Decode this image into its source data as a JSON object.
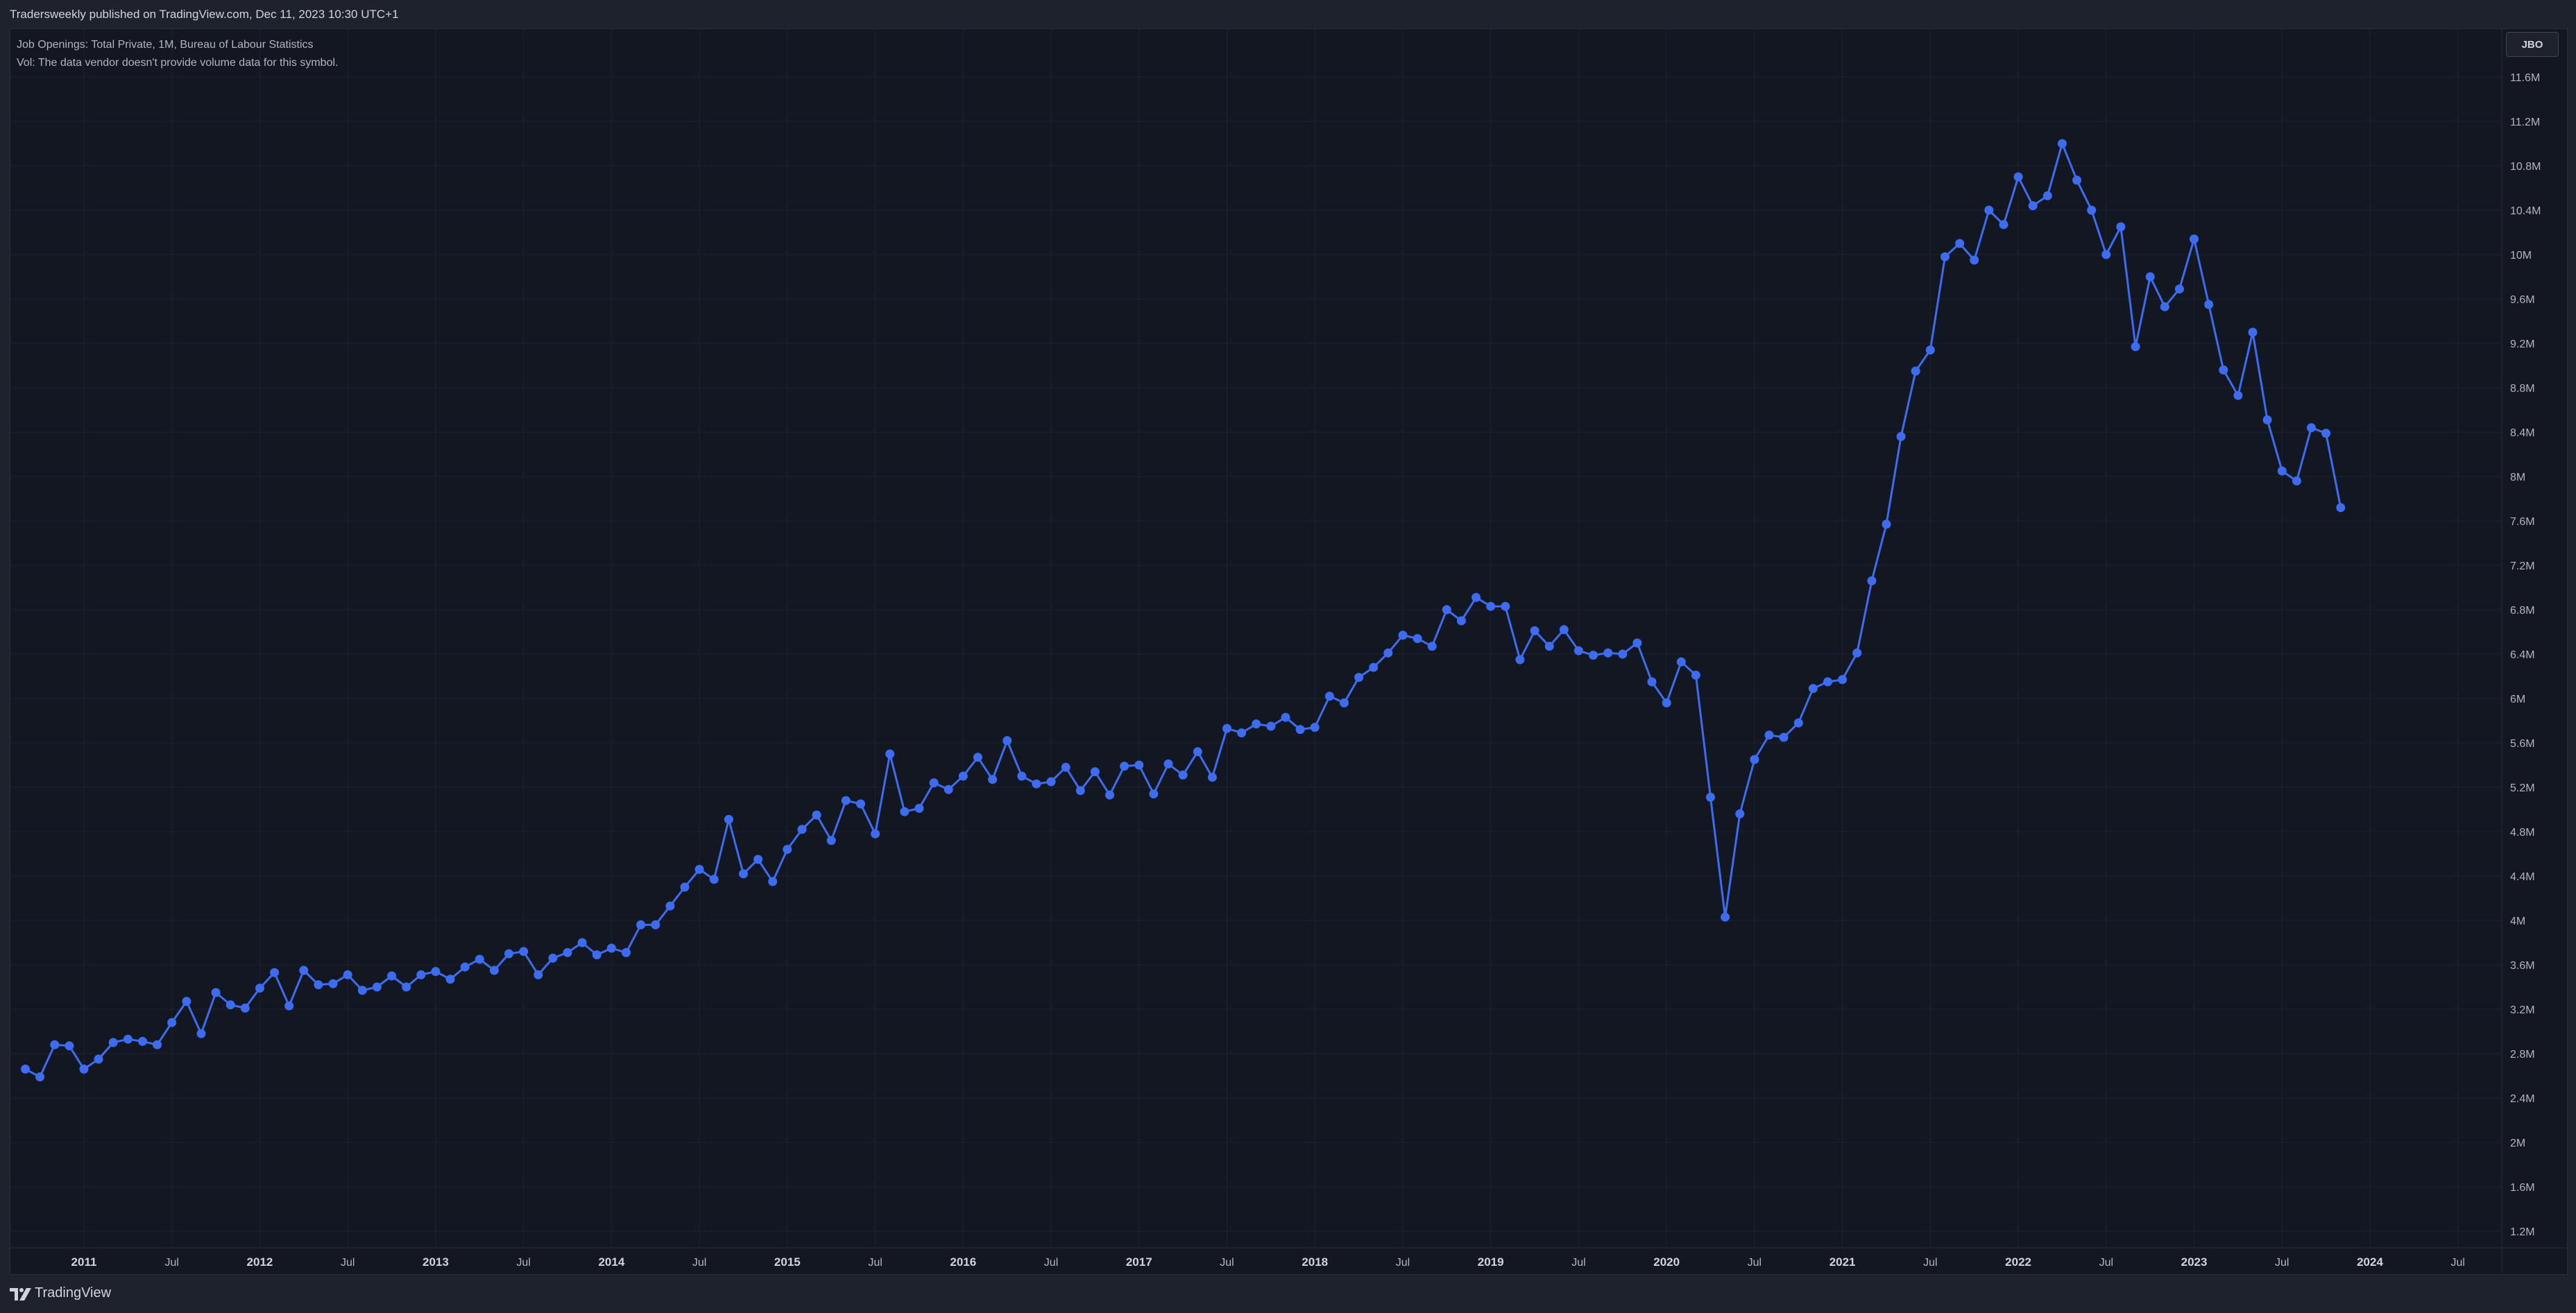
{
  "header": {
    "published_text": "Tradersweekly published on TradingView.com, Dec 11, 2023 10:30 UTC+1"
  },
  "legend": {
    "line1": "Job Openings: Total Private, 1M, Bureau of Labour Statistics",
    "line2": "Vol: The data vendor doesn't provide volume data for this symbol."
  },
  "symbol_label": "JBO",
  "footer": {
    "brand": "TradingView"
  },
  "colors": {
    "line": "#3d6cf0",
    "background": "#131722",
    "grid": "#1f2331"
  },
  "chart_data": {
    "type": "line",
    "title": "Job Openings: Total Private, 1M, Bureau of Labour Statistics",
    "xlabel": "",
    "ylabel": "",
    "x_start": "2010-09",
    "x_end": "2023-09",
    "x_frequency": "monthly",
    "ylim": [
      1000000,
      11800000
    ],
    "y_ticks": [
      "1.2M",
      "1.6M",
      "2M",
      "2.4M",
      "2.8M",
      "3.2M",
      "3.6M",
      "4M",
      "4.4M",
      "4.8M",
      "5.2M",
      "5.6M",
      "6M",
      "6.4M",
      "6.8M",
      "7.2M",
      "7.6M",
      "8M",
      "8.4M",
      "8.8M",
      "9.2M",
      "9.6M",
      "10M",
      "10.4M",
      "10.8M",
      "11.2M",
      "11.6M"
    ],
    "x_tick_labels": [
      "2011",
      "Jul",
      "2012",
      "Jul",
      "2013",
      "Jul",
      "2014",
      "Jul",
      "2015",
      "Jul",
      "2016",
      "Jul",
      "2017",
      "Jul",
      "2018",
      "Jul",
      "2019",
      "Jul",
      "2020",
      "Jul",
      "2021",
      "Jul",
      "2022",
      "Jul",
      "2023",
      "Jul",
      "2024",
      "Jul"
    ],
    "grid": true,
    "marker": "circle",
    "series": [
      {
        "values": [
          2660000,
          2590000,
          2880000,
          2870000,
          2660000,
          2750000,
          2900000,
          2930000,
          2910000,
          2880000,
          3080000,
          3270000,
          2980000,
          3350000,
          3240000,
          3210000,
          3390000,
          3530000,
          3230000,
          3550000,
          3420000,
          3430000,
          3510000,
          3370000,
          3400000,
          3500000,
          3400000,
          3510000,
          3540000,
          3470000,
          3580000,
          3650000,
          3550000,
          3700000,
          3720000,
          3510000,
          3660000,
          3710000,
          3800000,
          3690000,
          3750000,
          3710000,
          3960000,
          3960000,
          4130000,
          4300000,
          4460000,
          4370000,
          4910000,
          4420000,
          4550000,
          4350000,
          4640000,
          4820000,
          4950000,
          4720000,
          5080000,
          5050000,
          4780000,
          5500000,
          4980000,
          5010000,
          5240000,
          5180000,
          5300000,
          5470000,
          5270000,
          5620000,
          5300000,
          5230000,
          5250000,
          5380000,
          5170000,
          5340000,
          5130000,
          5390000,
          5400000,
          5140000,
          5410000,
          5310000,
          5520000,
          5290000,
          5730000,
          5690000,
          5770000,
          5750000,
          5830000,
          5720000,
          5740000,
          6020000,
          5960000,
          6190000,
          6280000,
          6410000,
          6570000,
          6540000,
          6470000,
          6800000,
          6700000,
          6910000,
          6830000,
          6830000,
          6350000,
          6610000,
          6470000,
          6620000,
          6430000,
          6390000,
          6410000,
          6400000,
          6500000,
          6150000,
          5960000,
          6330000,
          6210000,
          5110000,
          4030000,
          4960000,
          5450000,
          5670000,
          5650000,
          5780000,
          6090000,
          6150000,
          6170000,
          6410000,
          7060000,
          7570000,
          8360000,
          8950000,
          9140000,
          9980000,
          10100000,
          9950000,
          10400000,
          10270000,
          10700000,
          10440000,
          10530000,
          11000000,
          10670000,
          10400000,
          10000000,
          10250000,
          9170000,
          9800000,
          9530000,
          9690000,
          10140000,
          9550000,
          8960000,
          8730000,
          9300000,
          8510000,
          8050000,
          7960000,
          8440000,
          8390000,
          7720000
        ]
      }
    ]
  }
}
